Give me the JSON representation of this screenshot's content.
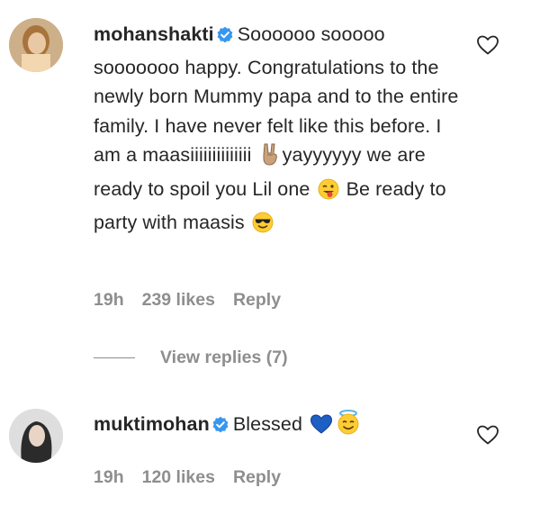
{
  "comments": [
    {
      "username": "mohanshakti",
      "verified": true,
      "text_parts": [
        "Soooooo sooooo sooooooo happy. Congratulations to the newly born Mummy papa and to the entire family. I have never felt like this before. I am a maasiiiiiiiiiiiiii ",
        "yayyyyyy we are ready to spoil you Lil one ",
        " Be ready to party with maasis "
      ],
      "emojis": [
        "victory-hand-emoji",
        "winking-tongue-face-emoji",
        "sunglasses-face-emoji"
      ],
      "time": "19h",
      "likes": "239 likes",
      "reply_label": "Reply",
      "view_replies": "View replies (7)"
    },
    {
      "username": "muktimohan",
      "verified": true,
      "text_parts": [
        "Blessed "
      ],
      "emojis": [
        "blue-heart-emoji",
        "halo-face-emoji"
      ],
      "time": "19h",
      "likes": "120 likes",
      "reply_label": "Reply"
    }
  ],
  "colors": {
    "text": "#262626",
    "muted": "#8e8e8e",
    "verified_blue": "#3797f0",
    "blue_heart": "#1d5fc4",
    "emoji_yellow": "#ffcc33"
  }
}
